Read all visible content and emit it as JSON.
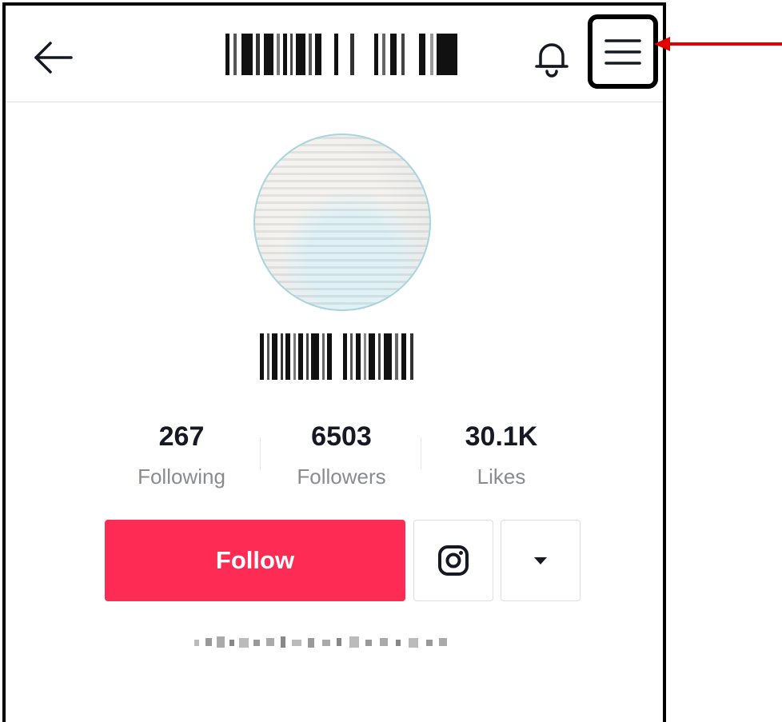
{
  "header": {
    "back_icon": "arrow-left-icon",
    "bell_icon": "bell-icon",
    "menu_icon": "hamburger-menu-icon"
  },
  "profile": {
    "stats": [
      {
        "value": "267",
        "label": "Following"
      },
      {
        "value": "6503",
        "label": "Followers"
      },
      {
        "value": "30.1K",
        "label": "Likes"
      }
    ],
    "follow_label": "Follow",
    "instagram_icon": "instagram-icon",
    "dropdown_icon": "caret-down-icon"
  },
  "colors": {
    "follow_button": "#fe2c55",
    "annotation_arrow": "#e00000",
    "stat_label": "#8a8b91"
  }
}
